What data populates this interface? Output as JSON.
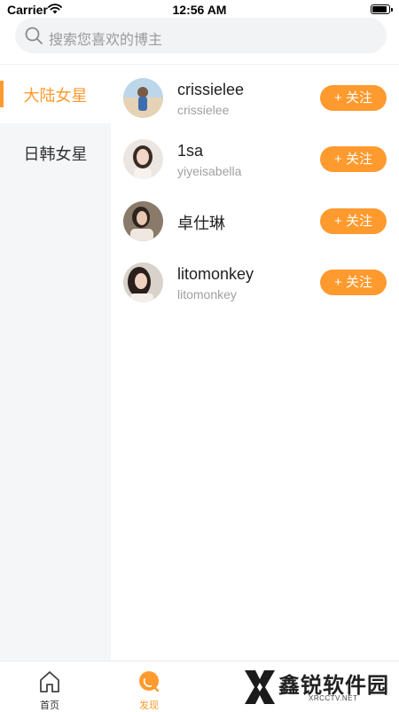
{
  "status_bar": {
    "carrier": "Carrier",
    "time": "12:56 AM"
  },
  "search": {
    "placeholder": "搜索您喜欢的博主"
  },
  "sidebar": {
    "items": [
      {
        "label": "大陆女星",
        "active": true
      },
      {
        "label": "日韩女星",
        "active": false
      }
    ]
  },
  "users": [
    {
      "name": "crissielee",
      "handle": "crissielee",
      "follow_label": "+ 关注"
    },
    {
      "name": "1sa",
      "handle": "yiyeisabella",
      "follow_label": "+ 关注"
    },
    {
      "name": "卓仕琳",
      "handle": "",
      "follow_label": "+ 关注"
    },
    {
      "name": "litomonkey",
      "handle": "litomonkey",
      "follow_label": "+ 关注"
    }
  ],
  "tab_bar": {
    "items": [
      {
        "label": "首页",
        "icon": "home-icon",
        "active": false
      },
      {
        "label": "发现",
        "icon": "discover-icon",
        "active": true
      }
    ]
  },
  "watermark": {
    "title": "鑫锐软件园",
    "subtitle": "XRCCTV.NET"
  },
  "colors": {
    "accent": "#ff9a2e",
    "sidebar_bg": "#f5f6f8",
    "search_bg": "#f2f3f5"
  }
}
